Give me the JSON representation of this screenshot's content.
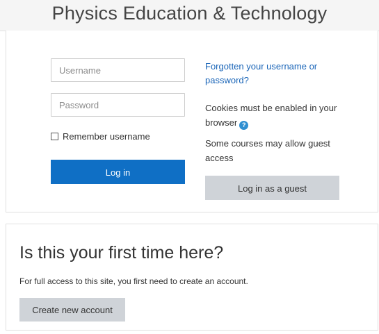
{
  "header": {
    "site_title": "Physics Education & Technology"
  },
  "login": {
    "username_placeholder": "Username",
    "password_placeholder": "Password",
    "remember_label": "Remember username",
    "remember_checked": false,
    "login_button_label": "Log in",
    "forgot_link": "Forgotten your username or password?",
    "cookies_text": "Cookies must be enabled in your browser",
    "help_icon": "question-circle-icon",
    "guest_text": "Some courses may allow guest access",
    "guest_button_label": "Log in as a guest"
  },
  "signup": {
    "heading": "Is this your first time here?",
    "text": "For full access to this site, you first need to create an account.",
    "create_button_label": "Create new account"
  },
  "colors": {
    "primary_button": "#0f6fc5",
    "secondary_button": "#cfd3d8",
    "link": "#1a65b8",
    "help_icon": "#2f8fd1"
  }
}
